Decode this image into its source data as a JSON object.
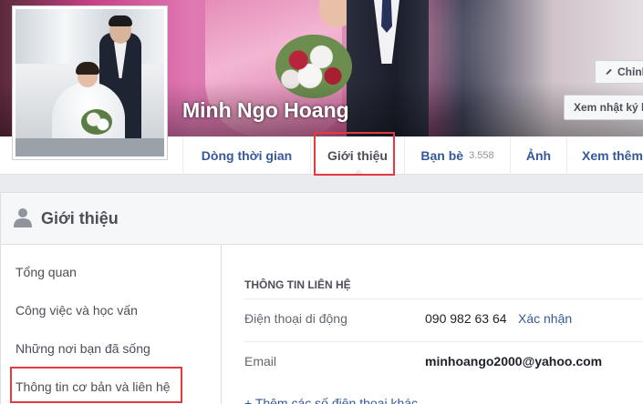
{
  "profile": {
    "name": "Minh Ngo Hoang"
  },
  "cover_buttons": {
    "edit_label": "Chỉnh",
    "view_activity_label": "Xem nhật ký h"
  },
  "nav": {
    "timeline": "Dòng thời gian",
    "about": "Giới thiệu",
    "friends": "Bạn bè",
    "friends_count": "3.558",
    "photos": "Ảnh",
    "more": "Xem thêm"
  },
  "about": {
    "title": "Giới thiệu",
    "sidebar": [
      "Tổng quan",
      "Công việc và học vấn",
      "Những nơi bạn đã sống",
      "Thông tin cơ bản và liên hệ"
    ],
    "contact_section_title": "THÔNG TIN LIÊN HỆ",
    "phone_label": "Điện thoại di động",
    "phone_value": "090 982 63 64",
    "verify_link": "Xác nhận",
    "email_label": "Email",
    "email_value": "minhoango2000@yahoo.com",
    "add_phone_link": "+ Thêm các số điện thoại khác"
  },
  "colors": {
    "link_blue": "#365899",
    "highlight_red": "#e5393f",
    "page_bg": "#e9ebee"
  }
}
